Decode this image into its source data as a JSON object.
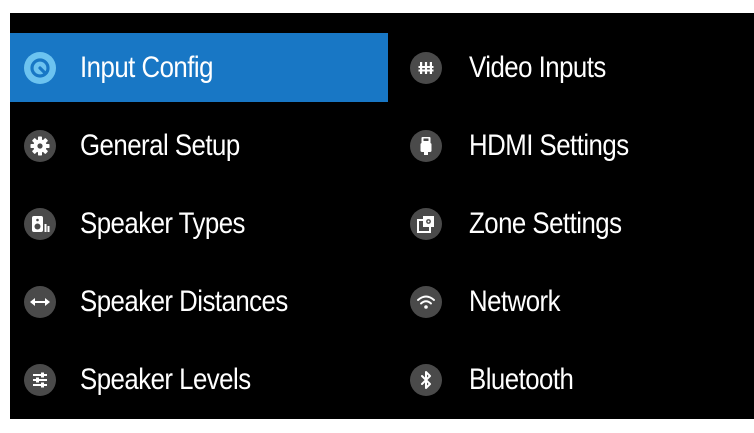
{
  "colors": {
    "background": "#000000",
    "selected": "#1877c5",
    "icon_bg": "#4a4a4a",
    "selected_icon_bg": "#6cc3f0",
    "text": "#ffffff"
  },
  "menu": {
    "left": [
      {
        "label": "Input Config",
        "icon": "input-config-icon",
        "selected": true
      },
      {
        "label": "General Setup",
        "icon": "gear-icon",
        "selected": false
      },
      {
        "label": "Speaker Types",
        "icon": "speaker-icon",
        "selected": false
      },
      {
        "label": "Speaker Distances",
        "icon": "double-arrow-icon",
        "selected": false
      },
      {
        "label": "Speaker Levels",
        "icon": "sliders-icon",
        "selected": false
      }
    ],
    "right": [
      {
        "label": "Video Inputs",
        "icon": "video-inputs-icon",
        "selected": false
      },
      {
        "label": "HDMI Settings",
        "icon": "hdmi-plug-icon",
        "selected": false
      },
      {
        "label": "Zone Settings",
        "icon": "zone-icon",
        "selected": false
      },
      {
        "label": "Network",
        "icon": "wifi-icon",
        "selected": false
      },
      {
        "label": "Bluetooth",
        "icon": "bluetooth-icon",
        "selected": false
      }
    ]
  }
}
